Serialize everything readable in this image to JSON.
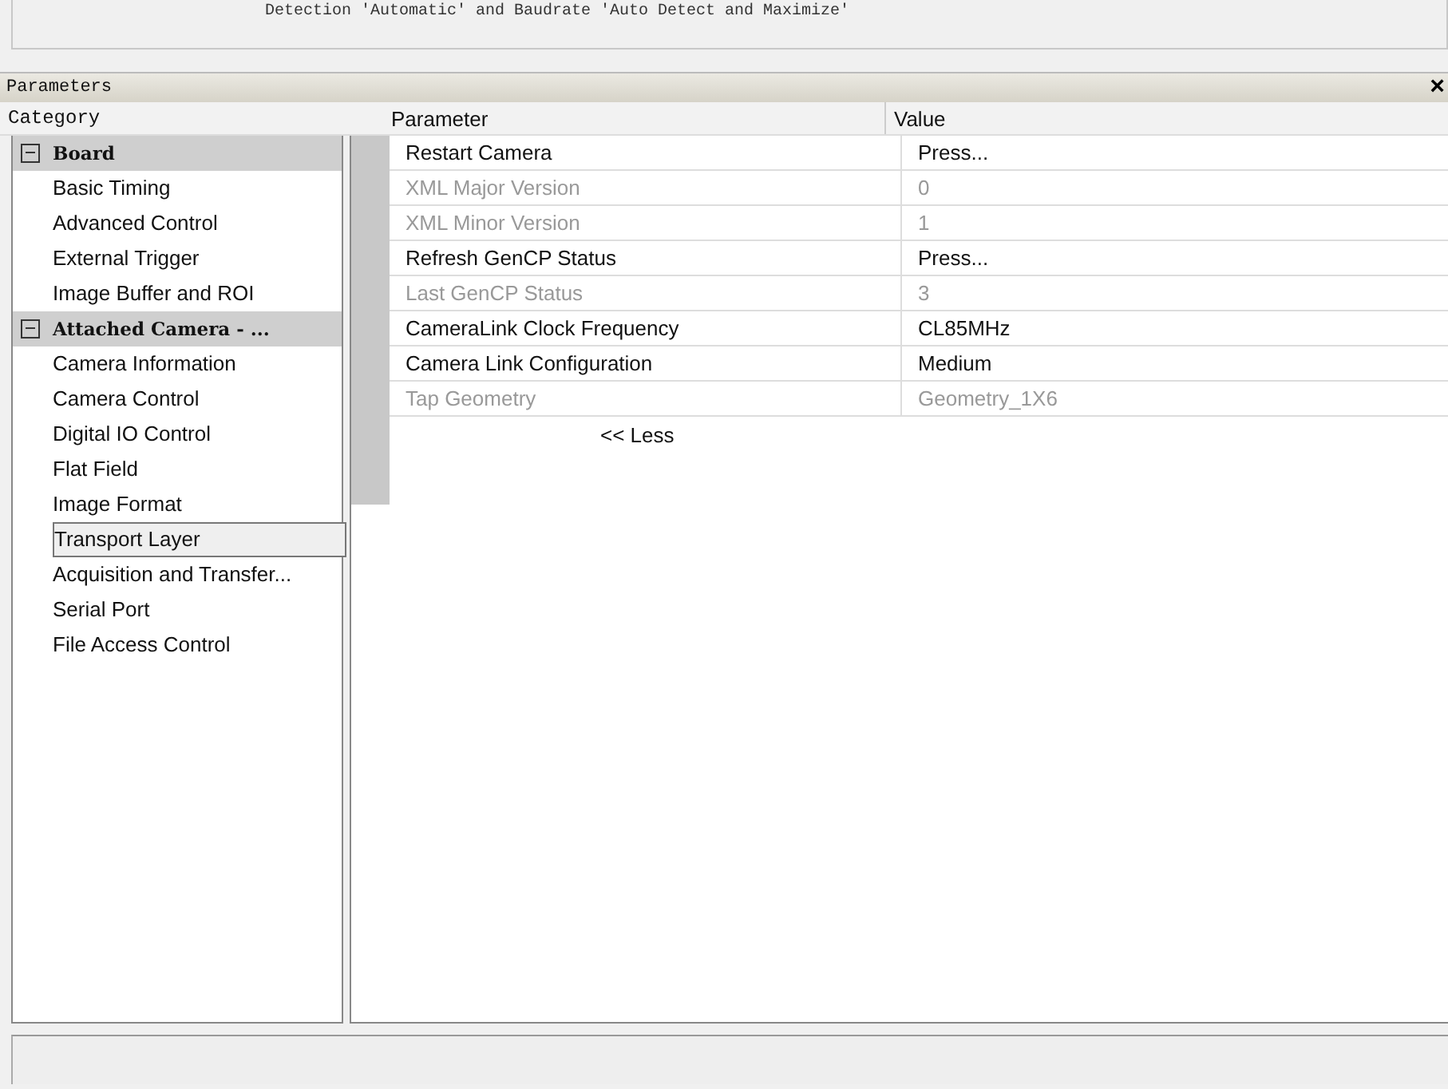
{
  "top_message": "Detection 'Automatic' and Baudrate 'Auto Detect and Maximize'",
  "panel": {
    "title": "Parameters",
    "close": "×"
  },
  "categories": {
    "header": "Category",
    "groups": [
      {
        "label": "Board",
        "expanded": true,
        "children": [
          {
            "label": "Basic Timing",
            "selected": false
          },
          {
            "label": "Advanced Control",
            "selected": false
          },
          {
            "label": "External Trigger",
            "selected": false
          },
          {
            "label": "Image Buffer and ROI",
            "selected": false
          }
        ]
      },
      {
        "label": "Attached Camera - ...",
        "expanded": true,
        "children": [
          {
            "label": "Camera Information",
            "selected": false
          },
          {
            "label": "Camera Control",
            "selected": false
          },
          {
            "label": "Digital IO Control",
            "selected": false
          },
          {
            "label": "Flat Field",
            "selected": false
          },
          {
            "label": "Image Format",
            "selected": false
          },
          {
            "label": "Transport Layer",
            "selected": true
          },
          {
            "label": "Acquisition and Transfer...",
            "selected": false
          },
          {
            "label": "Serial Port",
            "selected": false
          },
          {
            "label": "File Access Control",
            "selected": false
          }
        ]
      }
    ]
  },
  "table": {
    "columns": [
      "Parameter",
      "Value"
    ],
    "rows": [
      {
        "parameter": "Restart Camera",
        "value": "Press...",
        "disabled": false
      },
      {
        "parameter": "XML Major Version",
        "value": "0",
        "disabled": true
      },
      {
        "parameter": "XML Minor Version",
        "value": "1",
        "disabled": true
      },
      {
        "parameter": "Refresh GenCP Status",
        "value": "Press...",
        "disabled": false
      },
      {
        "parameter": "Last GenCP Status",
        "value": "3",
        "disabled": true
      },
      {
        "parameter": "CameraLink Clock Frequency",
        "value": "CL85MHz",
        "disabled": false
      },
      {
        "parameter": "Camera Link Configuration",
        "value": "Medium",
        "disabled": false
      },
      {
        "parameter": "Tap Geometry",
        "value": "Geometry_1X6",
        "disabled": true
      }
    ],
    "less_link": "<< Less"
  }
}
